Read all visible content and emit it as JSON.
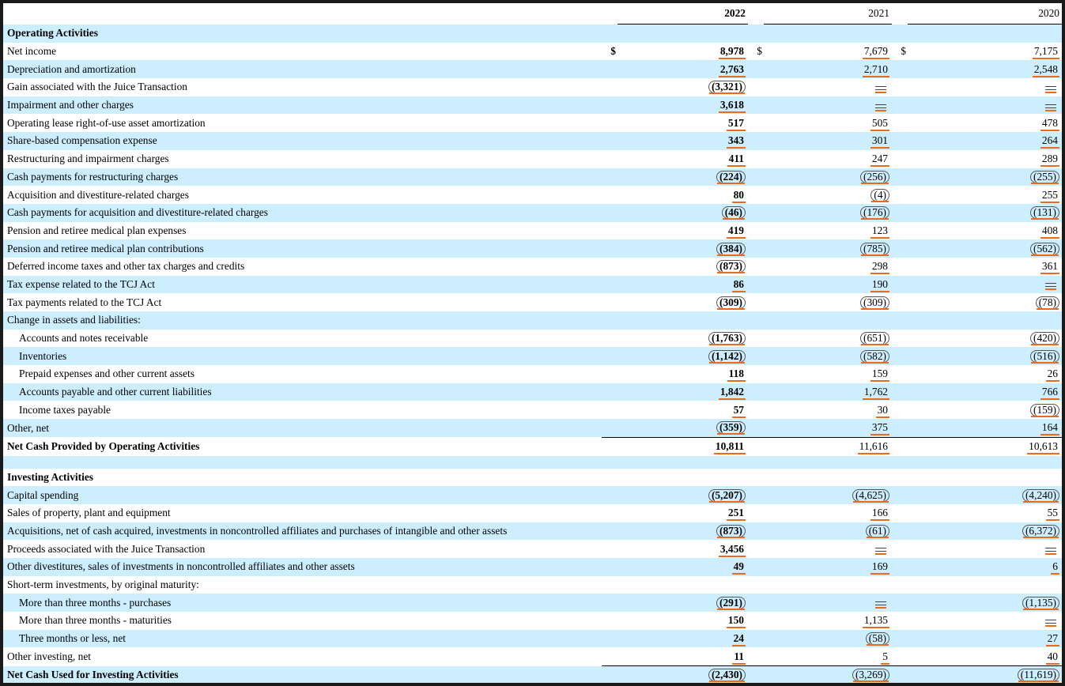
{
  "headers": {
    "y2022": "2022",
    "y2021": "2021",
    "y2020": "2020"
  },
  "accent_color": "#ec6a1b",
  "shade_color": "#cceeff",
  "rows": [
    {
      "label": "Operating Activities",
      "bold": true,
      "v22": "",
      "v21": "",
      "v20": ""
    },
    {
      "label": "Net income",
      "cur": "$",
      "v22": "8,978",
      "v21": "7,679",
      "v20": "7,175"
    },
    {
      "label": "Depreciation and amortization",
      "v22": "2,763",
      "v21": "2,710",
      "v20": "2,548"
    },
    {
      "label": "Gain associated with the Juice Transaction",
      "v22": "(3,321)",
      "v21": "—",
      "v20": "—"
    },
    {
      "label": "Impairment and other charges",
      "v22": "3,618",
      "v21": "—",
      "v20": "—"
    },
    {
      "label": "Operating lease right-of-use asset amortization",
      "v22": "517",
      "v21": "505",
      "v20": "478"
    },
    {
      "label": "Share-based compensation expense",
      "v22": "343",
      "v21": "301",
      "v20": "264"
    },
    {
      "label": "Restructuring and impairment charges",
      "v22": "411",
      "v21": "247",
      "v20": "289"
    },
    {
      "label": "Cash payments for restructuring charges",
      "v22": "(224)",
      "v21": "(256)",
      "v20": "(255)"
    },
    {
      "label": "Acquisition and divestiture-related charges",
      "v22": "80",
      "v21": "(4)",
      "v20": "255"
    },
    {
      "label": "Cash payments for acquisition and divestiture-related charges",
      "v22": "(46)",
      "v21": "(176)",
      "v20": "(131)"
    },
    {
      "label": "Pension and retiree medical plan expenses",
      "v22": "419",
      "v21": "123",
      "v20": "408"
    },
    {
      "label": "Pension and retiree medical plan contributions",
      "v22": "(384)",
      "v21": "(785)",
      "v20": "(562)"
    },
    {
      "label": "Deferred income taxes and other tax charges and credits",
      "v22": "(873)",
      "v21": "298",
      "v20": "361"
    },
    {
      "label": "Tax expense related to the TCJ Act",
      "v22": "86",
      "v21": "190",
      "v20": "—"
    },
    {
      "label": "Tax payments related to the TCJ Act",
      "v22": "(309)",
      "v21": "(309)",
      "v20": "(78)"
    },
    {
      "label": "Change in assets and liabilities:",
      "v22": "",
      "v21": "",
      "v20": ""
    },
    {
      "label": "Accounts and notes receivable",
      "indent": true,
      "v22": "(1,763)",
      "v21": "(651)",
      "v20": "(420)"
    },
    {
      "label": "Inventories",
      "indent": true,
      "v22": "(1,142)",
      "v21": "(582)",
      "v20": "(516)"
    },
    {
      "label": "Prepaid expenses and other current assets",
      "indent": true,
      "v22": "118",
      "v21": "159",
      "v20": "26"
    },
    {
      "label": "Accounts payable and other current liabilities",
      "indent": true,
      "v22": "1,842",
      "v21": "1,762",
      "v20": "766"
    },
    {
      "label": "Income taxes payable",
      "indent": true,
      "v22": "57",
      "v21": "30",
      "v20": "(159)"
    },
    {
      "label": "Other, net",
      "v22": "(359)",
      "v21": "375",
      "v20": "164"
    },
    {
      "label": "Net Cash Provided by Operating Activities",
      "bold": true,
      "total": true,
      "v22": "10,811",
      "v21": "11,616",
      "v20": "10,613"
    },
    {
      "gap": true
    },
    {
      "label": "Investing Activities",
      "bold": true,
      "v22": "",
      "v21": "",
      "v20": ""
    },
    {
      "label": "Capital spending",
      "v22": "(5,207)",
      "v21": "(4,625)",
      "v20": "(4,240)"
    },
    {
      "label": "Sales of property, plant and equipment",
      "v22": "251",
      "v21": "166",
      "v20": "55"
    },
    {
      "label": "Acquisitions, net of cash acquired, investments in noncontrolled affiliates and purchases of intangible and other assets",
      "v22": "(873)",
      "v21": "(61)",
      "v20": "(6,372)"
    },
    {
      "label": "Proceeds associated with the Juice Transaction",
      "v22": "3,456",
      "v21": "—",
      "v20": "—"
    },
    {
      "label": "Other divestitures, sales of investments in noncontrolled affiliates and other assets",
      "v22": "49",
      "v21": "169",
      "v20": "6"
    },
    {
      "label": "Short-term investments, by original maturity:",
      "v22": "",
      "v21": "",
      "v20": ""
    },
    {
      "label": "More than three months - purchases",
      "indent": true,
      "v22": "(291)",
      "v21": "—",
      "v20": "(1,135)"
    },
    {
      "label": "More than three months - maturities",
      "indent": true,
      "v22": "150",
      "v21": "1,135",
      "v20": "—"
    },
    {
      "label": "Three months or less, net",
      "indent": true,
      "v22": "24",
      "v21": "(58)",
      "v20": "27"
    },
    {
      "label": "Other investing, net",
      "v22": "11",
      "v21": "5",
      "v20": "40"
    },
    {
      "label": "Net Cash Used for Investing Activities",
      "bold": true,
      "total": true,
      "v22": "(2,430)",
      "v21": "(3,269)",
      "v20": "(11,619)"
    }
  ]
}
